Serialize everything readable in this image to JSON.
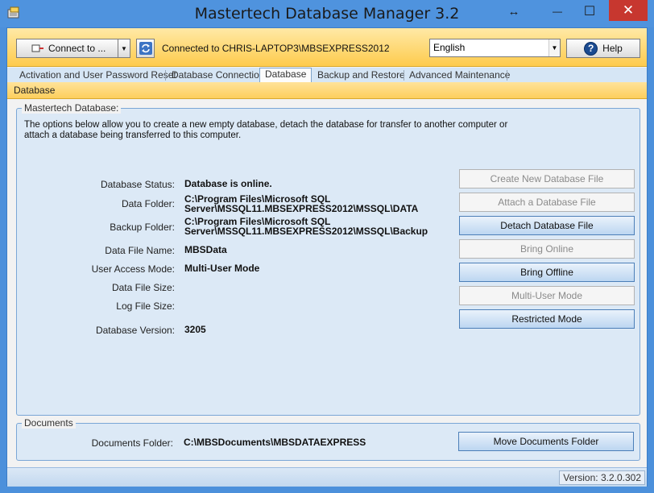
{
  "window": {
    "title": "Mastertech Database Manager 3.2",
    "restore_glyph": "↔",
    "min_glyph": "—",
    "max_glyph": "☐",
    "close_glyph": "✕"
  },
  "toolbar": {
    "connect_label": "Connect to ...",
    "connection_status": "Connected to CHRIS-LAPTOP3\\MBSEXPRESS2012",
    "language": "English",
    "help_label": "Help",
    "help_glyph": "?"
  },
  "tabs": [
    {
      "label": "Activation and User Password Reset"
    },
    {
      "label": "Database Connection"
    },
    {
      "label": "Database"
    },
    {
      "label": "Backup and Restore"
    },
    {
      "label": "Advanced Maintenance"
    }
  ],
  "section_title": "Database",
  "db_group": {
    "title": "Mastertech Database:",
    "intro": "The options below allow you to create a new empty database, detach the database for transfer to another computer or attach a database being transferred to this computer.",
    "fields": [
      {
        "label": "Database Status:",
        "value": "Database is online."
      },
      {
        "label": "Data Folder:",
        "value": "C:\\Program Files\\Microsoft SQL Server\\MSSQL11.MBSEXPRESS2012\\MSSQL\\DATA"
      },
      {
        "label": "Backup Folder:",
        "value": "C:\\Program Files\\Microsoft SQL Server\\MSSQL11.MBSEXPRESS2012\\MSSQL\\Backup"
      },
      {
        "label": "Data File Name:",
        "value": "MBSData"
      },
      {
        "label": "User Access Mode:",
        "value": "Multi-User Mode"
      },
      {
        "label": "Data File Size:",
        "value": ""
      },
      {
        "label": "Log File Size:",
        "value": ""
      },
      {
        "label": "Database Version:",
        "value": "3205"
      }
    ],
    "actions": [
      {
        "label": "Create New Database File",
        "enabled": false
      },
      {
        "label": "Attach a Database File",
        "enabled": false
      },
      {
        "label": "Detach Database File",
        "enabled": true
      },
      {
        "label": "Bring Online",
        "enabled": false
      },
      {
        "label": "Bring Offline",
        "enabled": true
      },
      {
        "label": "Multi-User Mode",
        "enabled": false
      },
      {
        "label": "Restricted Mode",
        "enabled": true
      }
    ]
  },
  "documents_group": {
    "title": "Documents",
    "folder_label": "Documents Folder:",
    "folder_value": "C:\\MBSDocuments\\MBSDATAEXPRESS",
    "move_label": "Move Documents Folder"
  },
  "status": {
    "version": "Version: 3.2.0.302"
  }
}
